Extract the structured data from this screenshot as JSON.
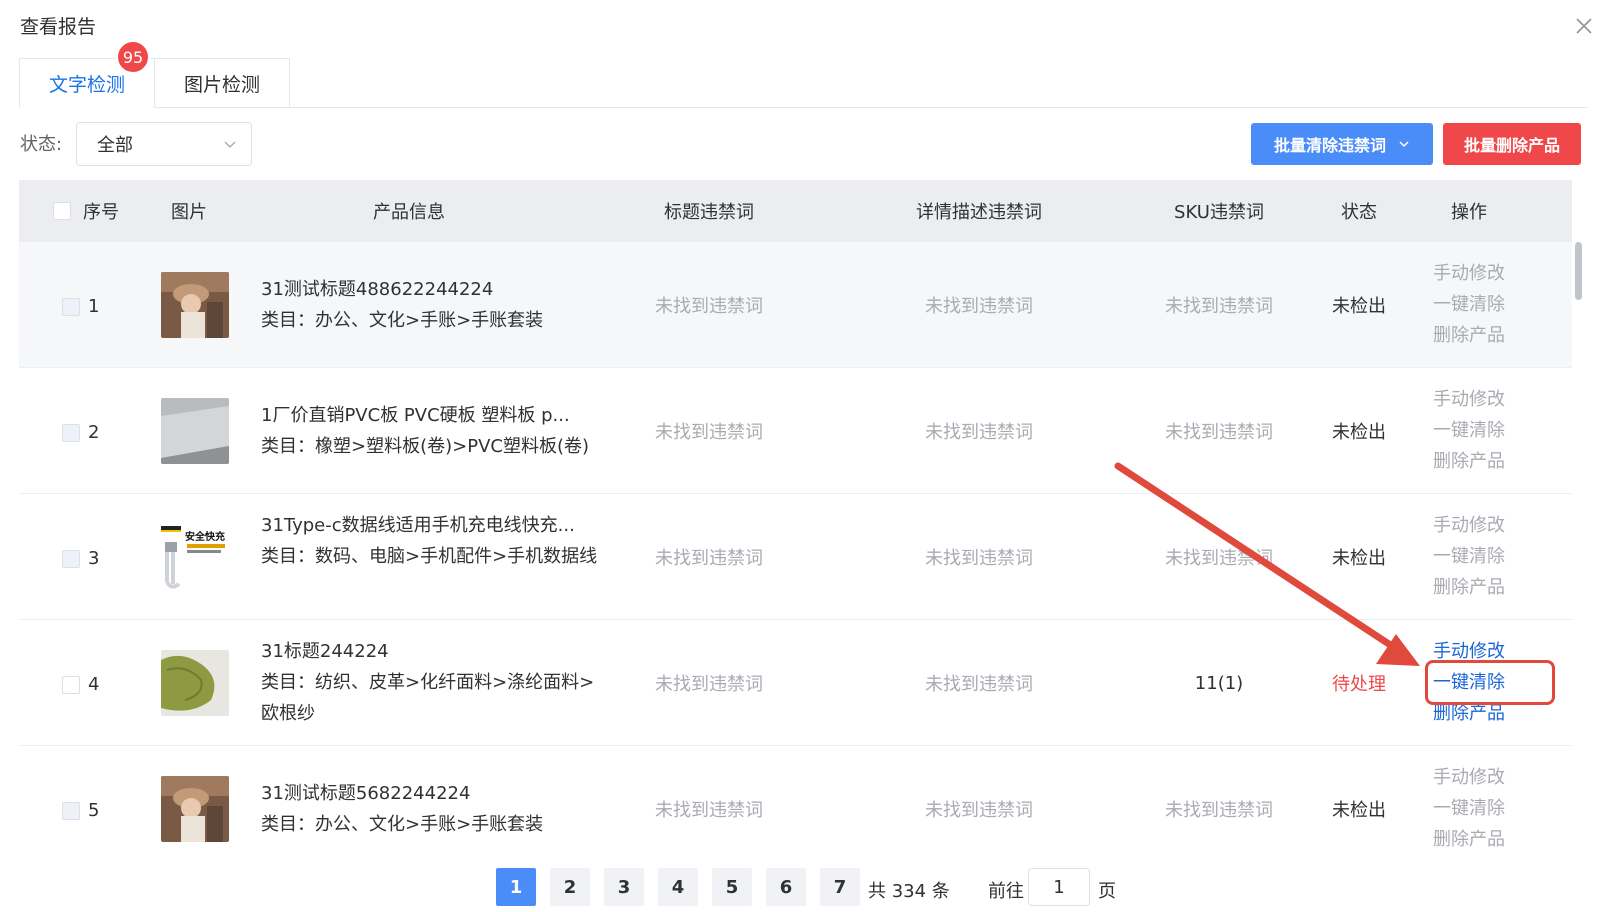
{
  "dialog": {
    "title": "查看报告"
  },
  "tabs": [
    {
      "label": "文字检测",
      "badge": "95"
    },
    {
      "label": "图片检测"
    }
  ],
  "filter": {
    "label": "状态:",
    "value": "全部"
  },
  "actions": {
    "batch_clear": "批量清除违禁词",
    "batch_delete": "批量删除产品"
  },
  "table": {
    "headers": [
      "序号",
      "图片",
      "产品信息",
      "标题违禁词",
      "详情描述违禁词",
      "SKU违禁词",
      "状态",
      "操作"
    ],
    "rows": [
      {
        "seq": "1",
        "title": "31测试标题488622244224",
        "category": "类目：办公、文化>手账>手账套装",
        "title_words": "未找到违禁词",
        "desc_words": "未找到违禁词",
        "sku_words": "未找到违禁词",
        "status": "未检出",
        "ops": [
          "手动修改",
          "一键清除",
          "删除产品"
        ]
      },
      {
        "seq": "2",
        "title": "1厂价直销PVC板 PVC硬板 塑料板 p...",
        "category": "类目：橡塑>塑料板(卷)>PVC塑料板(卷)",
        "title_words": "未找到违禁词",
        "desc_words": "未找到违禁词",
        "sku_words": "未找到违禁词",
        "status": "未检出",
        "ops": [
          "手动修改",
          "一键清除",
          "删除产品"
        ]
      },
      {
        "seq": "3",
        "title": "31Type-c数据线适用手机充电线快充...",
        "category": "类目：数码、电脑>手机配件>手机数据线",
        "title_words": "未找到违禁词",
        "desc_words": "未找到违禁词",
        "sku_words": "未找到违禁词",
        "status": "未检出",
        "ops": [
          "手动修改",
          "一键清除",
          "删除产品"
        ],
        "thumb_text": "安全快充"
      },
      {
        "seq": "4",
        "title": "31标题244224",
        "category": "类目：纺织、皮革>化纤面料>涤纶面料>欧根纱",
        "title_words": "未找到违禁词",
        "desc_words": "未找到违禁词",
        "sku_words": "11(1)",
        "status": "待处理",
        "ops": [
          "手动修改",
          "一键清除",
          "删除产品"
        ]
      },
      {
        "seq": "5",
        "title": "31测试标题5682244224",
        "category": "类目：办公、文化>手账>手账套装",
        "title_words": "未找到违禁词",
        "desc_words": "未找到违禁词",
        "sku_words": "未找到违禁词",
        "status": "未检出",
        "ops": [
          "手动修改",
          "一键清除",
          "删除产品"
        ]
      }
    ]
  },
  "pagination": {
    "pages": [
      "1",
      "2",
      "3",
      "4",
      "5",
      "6",
      "7"
    ],
    "current": "1",
    "total": "共 334 条",
    "goto_label": "前往",
    "goto_value": "1",
    "page_suffix": "页"
  },
  "colors": {
    "accent": "#4b8df8",
    "danger": "#f0484a",
    "annotation": "#e04a3c"
  }
}
